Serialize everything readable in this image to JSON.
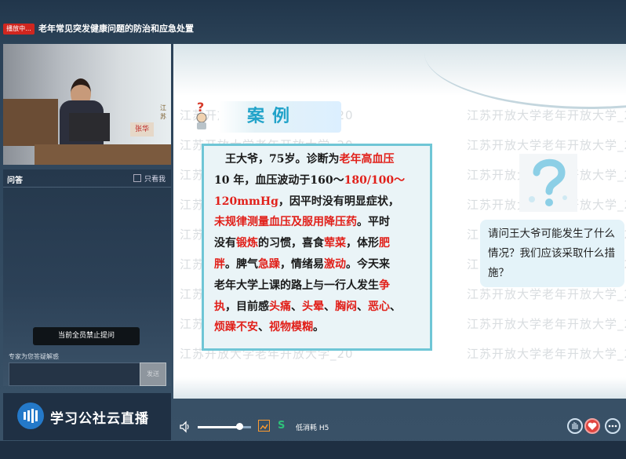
{
  "header": {
    "live_badge": "播放中...",
    "title": "老年常见突发健康问题的防治和应急处置"
  },
  "video": {
    "name_card": "张华",
    "corner_text": "江苏"
  },
  "qa": {
    "title": "问答",
    "only_me_label": "只看我",
    "banned_notice": "当前全员禁止提问",
    "expert_label": "专家为您答疑解惑",
    "input_placeholder": "",
    "send_label": "发送"
  },
  "brand": {
    "name": "学习公社云直播"
  },
  "slide": {
    "case_title": "案例",
    "case_lines": [
      {
        "parts": [
          {
            "t": "　王大爷，75岁。诊断为",
            "red": false
          },
          {
            "t": "老年高血压",
            "red": true
          }
        ]
      },
      {
        "parts": [
          {
            "t": "10 年，血压波动于160～",
            "red": false
          },
          {
            "t": "180/100～",
            "red": true
          }
        ]
      },
      {
        "parts": [
          {
            "t": "120mmHg",
            "red": true
          },
          {
            "t": "，因平时没有明显症状，",
            "red": false
          }
        ]
      },
      {
        "parts": [
          {
            "t": "未规律测量血压及服用降压药",
            "red": true
          },
          {
            "t": "。平时",
            "red": false
          }
        ]
      },
      {
        "parts": [
          {
            "t": "没有",
            "red": false
          },
          {
            "t": "锻炼",
            "red": true
          },
          {
            "t": "的习惯，喜食",
            "red": false
          },
          {
            "t": "荤菜",
            "red": true
          },
          {
            "t": "，体形",
            "red": false
          },
          {
            "t": "肥",
            "red": true
          }
        ]
      },
      {
        "parts": [
          {
            "t": "胖",
            "red": true
          },
          {
            "t": "。脾气",
            "red": false
          },
          {
            "t": "急躁",
            "red": true
          },
          {
            "t": "，情绪易",
            "red": false
          },
          {
            "t": "激动",
            "red": true
          },
          {
            "t": "。今天来",
            "red": false
          }
        ]
      },
      {
        "parts": [
          {
            "t": "老年大学上课的路上与一行人发生",
            "red": false
          },
          {
            "t": "争",
            "red": true
          }
        ]
      },
      {
        "parts": [
          {
            "t": "执",
            "red": true
          },
          {
            "t": "，目前感",
            "red": false
          },
          {
            "t": "头痛",
            "red": true
          },
          {
            "t": "、",
            "red": false
          },
          {
            "t": "头晕",
            "red": true
          },
          {
            "t": "、",
            "red": false
          },
          {
            "t": "胸闷",
            "red": true
          },
          {
            "t": "、",
            "red": false
          },
          {
            "t": "恶心",
            "red": true
          },
          {
            "t": "、",
            "red": false
          }
        ]
      },
      {
        "parts": [
          {
            "t": "烦躁不安",
            "red": true
          },
          {
            "t": "、",
            "red": false
          },
          {
            "t": "视物模糊",
            "red": true
          },
          {
            "t": "。",
            "red": false
          }
        ]
      }
    ],
    "question": "请问王大爷可能发生了什么情况？我们应该采取什么措施？",
    "watermark": "江苏开放大学老年开放大学_20"
  },
  "controls": {
    "volume_level": 0.78,
    "low_power_label": "低消耗 H5"
  },
  "colors": {
    "accent_red": "#e1201a",
    "case_border": "#6fc6d6",
    "brand_blue": "#2479c9"
  }
}
